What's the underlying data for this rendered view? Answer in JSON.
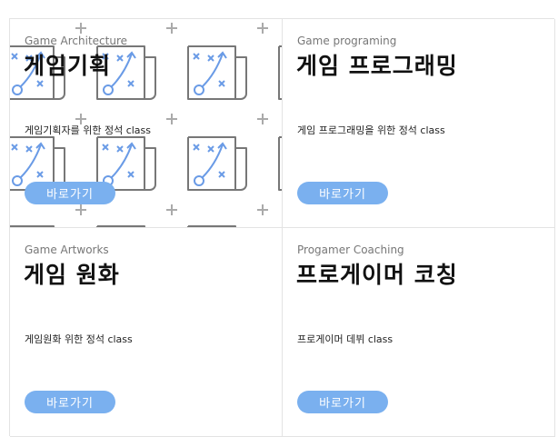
{
  "colors": {
    "button": "#7ab0ef",
    "pattern_icon": "#6a9be6",
    "pattern_line": "#777777",
    "border": "#e3e3e3"
  },
  "cards": [
    {
      "subtitle": "Game Architecture",
      "title": "게임기획",
      "desc": "게임기획자를 위한 정석 class",
      "button": "바로가기",
      "background_icon": "strategy-playbook-pattern"
    },
    {
      "subtitle": "Game programing",
      "title": "게임 프로그래밍",
      "desc": "게임 프로그래밍을 위한 정석 class",
      "button": "바로가기"
    },
    {
      "subtitle": "Game Artworks",
      "title": "게임 원화",
      "desc": "게임원화 위한 정석 class",
      "button": "바로가기"
    },
    {
      "subtitle": "Progamer Coaching",
      "title": "프로게이머 코칭",
      "desc": "프로게이머 데뷔 class",
      "button": "바로가기"
    }
  ]
}
